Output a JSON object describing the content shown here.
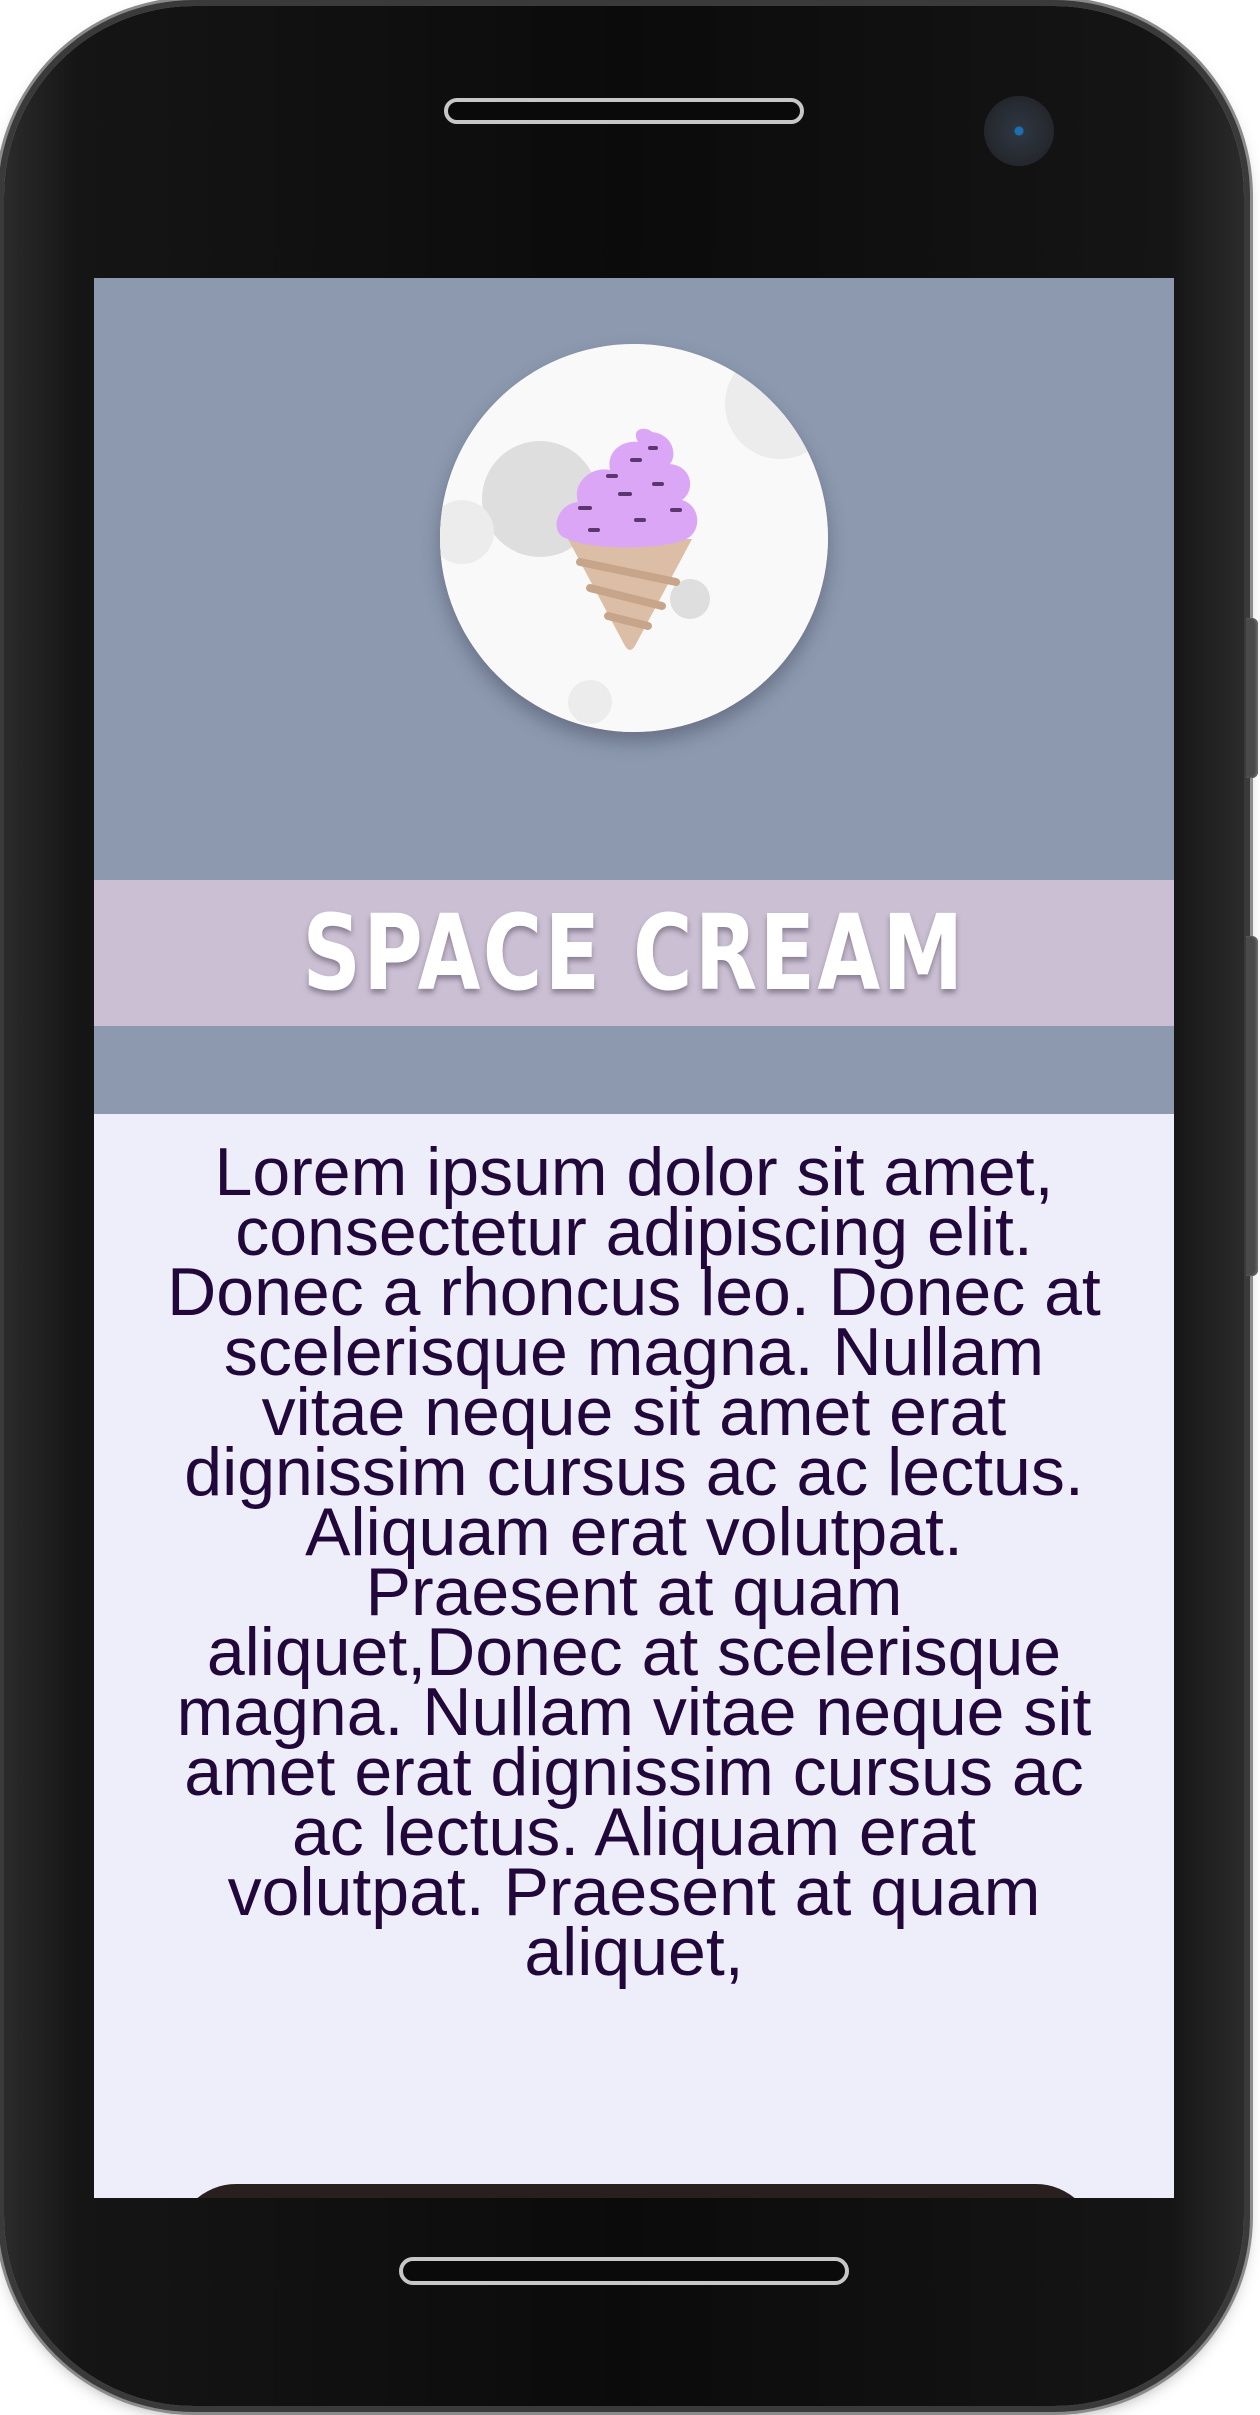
{
  "app": {
    "title": "SPACE CREAM",
    "logo_icon": "ice-cream-moon-icon"
  },
  "content": {
    "description": "Lorem ipsum dolor sit amet, consectetur adipiscing elit. Donec a rhoncus leo. Donec at scelerisque magna. Nullam vitae neque sit amet erat dignissim cursus ac ac lectus. Aliquam erat volutpat. Praesent at quam aliquet,Donec at scelerisque magna. Nullam vitae neque sit amet erat dignissim cursus ac ac lectus. Aliquam erat volutpat. Praesent at quam aliquet,"
  },
  "colors": {
    "hero_background": "#8c99af",
    "banner_background": "#cbbfd3",
    "page_background": "#edeef9",
    "text": "#22073a",
    "ice_cream": "#dba6f6",
    "cone": "#dbbda5"
  }
}
